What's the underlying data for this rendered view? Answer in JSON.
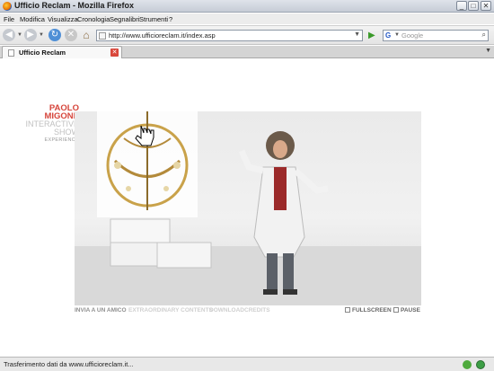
{
  "window": {
    "title": "Ufficio Reclam - Mozilla Firefox",
    "buttons": {
      "minimize": "_",
      "maximize": "□",
      "close": "✕"
    }
  },
  "menu": [
    "File",
    "Modifica",
    "Visualizza",
    "Cronologia",
    "Segnalibri",
    "Strumenti",
    "?"
  ],
  "navigation": {
    "url": "http://www.ufficioreclam.it/index.asp",
    "search_placeholder": "Google",
    "search_engine_letter": "G"
  },
  "tab": {
    "label": "Ufficio Reclam"
  },
  "logo": {
    "line1": "PAOLO",
    "line2": "MIGONE",
    "line3": "INTERACTIVE",
    "line4": "SHOW",
    "line5": "EXPERIENCE"
  },
  "video_controls": {
    "invia": "INVIA A UN AMICO",
    "extra": "EXTRAORDINARY CONTENTS",
    "download": "DOWNLOAD",
    "credits": "CREDITS",
    "fullscreen": "FULLSCREEN",
    "pause": "PAUSE"
  },
  "status": {
    "text": "Trasferimento dati da www.ufficioreclam.it..."
  },
  "colors": {
    "logo_accent": "#d6453b",
    "titlebar": "#c6ccd6"
  }
}
